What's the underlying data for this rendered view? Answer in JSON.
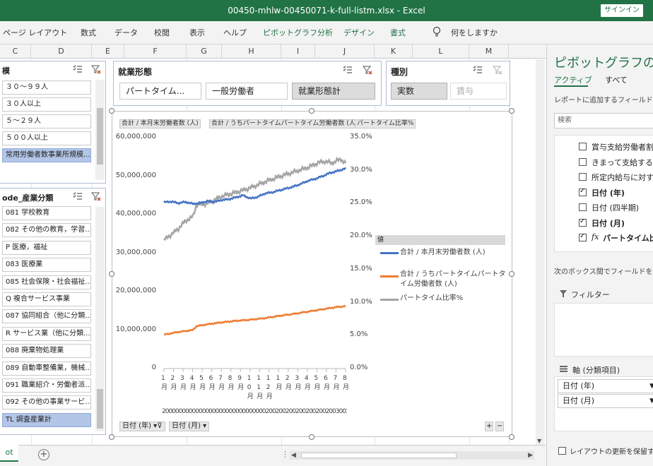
{
  "window": {
    "title": "00450-mhlw-00450071-k-full-listm.xlsx  -  Excel",
    "signin": "サインイン"
  },
  "ribbon": {
    "tabs": [
      "ページ レイアウト",
      "数式",
      "データ",
      "校閲",
      "表示",
      "ヘルプ",
      "ピボットグラフ分析",
      "デザイン",
      "書式"
    ],
    "tellme": "何をしますか"
  },
  "columns": [
    "C",
    "D",
    "E",
    "F",
    "G",
    "H",
    "I",
    "J",
    "K",
    "L",
    "M"
  ],
  "slicer_size": {
    "title": "模",
    "items": [
      "３０～９９人",
      "３０人以上",
      "５～２９人",
      "５００人以上",
      "常用労働者数事業所規模..."
    ],
    "selected_index": 4
  },
  "slicer_industry": {
    "title": "ode_産業分類",
    "items": [
      "081 学校教育",
      "082 その他の教育，学習...",
      "P 医療，福祉",
      "083 医療業",
      "085 社会保険・社会福祉...",
      "Q 複合サービス事業",
      "087 協同組合（他に分類...",
      "R サービス業（他に分類...",
      "088 廃棄物処理業",
      "089 自動車整備業，機械...",
      "091 職業紹介・労働者派...",
      "092 その他の事業サービ...",
      "TL 調査産業計"
    ],
    "selected_index": 12
  },
  "slicer_employment": {
    "title": "就業形態",
    "items": [
      "パートタイム...",
      "一般労働者",
      "就業形態計"
    ],
    "selected_index": 2
  },
  "slicer_type": {
    "title": "種別",
    "items": [
      "実数",
      "賃与"
    ],
    "selected_index": 0
  },
  "chart": {
    "field_buttons": [
      "合計 / 本月末労働者数 (人)",
      "合計 / うちパートタイムパートタイム労働者数 (人)",
      "パートタイム比率%"
    ],
    "axis_buttons": [
      "日付 (年)",
      "日付 (月)"
    ],
    "legend_header": "値",
    "legend": [
      "合計 / 本月末労働者数 (人)",
      "合計 / うちパートタイムパートタイム労働者数 (人)",
      "パートタイム比率%"
    ],
    "x_month_labels": [
      "1月",
      "2月",
      "3月",
      "4月",
      "5月",
      "6月",
      "7月",
      "8月",
      "9月",
      "10月",
      "11月",
      "12月",
      "1月",
      "2月",
      "3月",
      "4月",
      "5月",
      "6月",
      "7月",
      "8月"
    ],
    "x_year_strip": "20000000000000000000000000000002002002002002002002003003001",
    "colors": {
      "total": "#4472c4",
      "part": "#ed7d31",
      "ratio": "#a5a5a5"
    }
  },
  "chart_data": {
    "type": "line",
    "title": "",
    "y_left": {
      "ticks": [
        "0",
        "10,000,000",
        "20,000,000",
        "30,000,000",
        "40,000,000",
        "50,000,000",
        "60,000,000"
      ],
      "ylim": [
        0,
        60000000
      ]
    },
    "y_right": {
      "ticks": [
        "0.0%",
        "5.0%",
        "10.0%",
        "15.0%",
        "20.0%",
        "25.0%",
        "30.0%",
        "35.0%"
      ],
      "ylim": [
        0,
        35
      ]
    },
    "n_points": 253,
    "series": [
      {
        "name": "合計 / 本月末労働者数 (人)",
        "axis": "left",
        "points": [
          [
            0,
            43200000
          ],
          [
            10,
            43400000
          ],
          [
            20,
            43000000
          ],
          [
            30,
            43300000
          ],
          [
            40,
            42800000
          ],
          [
            50,
            43000000
          ],
          [
            60,
            43500000
          ],
          [
            70,
            43300000
          ],
          [
            80,
            43800000
          ],
          [
            90,
            44000000
          ],
          [
            100,
            44500000
          ],
          [
            110,
            45000000
          ],
          [
            120,
            44200000
          ],
          [
            130,
            44600000
          ],
          [
            140,
            45500000
          ],
          [
            150,
            45800000
          ],
          [
            160,
            46300000
          ],
          [
            170,
            46800000
          ],
          [
            180,
            47300000
          ],
          [
            190,
            48000000
          ],
          [
            200,
            48800000
          ],
          [
            210,
            49300000
          ],
          [
            220,
            50000000
          ],
          [
            230,
            50800000
          ],
          [
            240,
            51300000
          ],
          [
            252,
            52000000
          ]
        ]
      },
      {
        "name": "合計 / うちパートタイムパートタイム労働者数 (人)",
        "axis": "left",
        "points": [
          [
            0,
            8800000
          ],
          [
            20,
            9500000
          ],
          [
            40,
            10000000
          ],
          [
            45,
            11000000
          ],
          [
            60,
            11500000
          ],
          [
            80,
            12000000
          ],
          [
            100,
            12400000
          ],
          [
            120,
            12700000
          ],
          [
            140,
            13100000
          ],
          [
            160,
            13700000
          ],
          [
            180,
            14200000
          ],
          [
            200,
            14800000
          ],
          [
            220,
            15400000
          ],
          [
            240,
            16000000
          ],
          [
            252,
            16200000
          ]
        ]
      },
      {
        "name": "パートタイム比率%",
        "axis": "right",
        "points": [
          [
            0,
            19.5
          ],
          [
            10,
            20.3
          ],
          [
            20,
            21.2
          ],
          [
            30,
            22.4
          ],
          [
            40,
            23.0
          ],
          [
            45,
            24.8
          ],
          [
            60,
            25.0
          ],
          [
            80,
            26.1
          ],
          [
            100,
            26.7
          ],
          [
            120,
            27.4
          ],
          [
            140,
            28.3
          ],
          [
            160,
            29.1
          ],
          [
            180,
            29.8
          ],
          [
            200,
            30.5
          ],
          [
            210,
            31.0
          ],
          [
            220,
            31.4
          ],
          [
            235,
            31.2
          ],
          [
            245,
            31.8
          ],
          [
            252,
            31.0
          ]
        ]
      }
    ]
  },
  "pane": {
    "title": "ピボットグラフのフィ",
    "tabs": [
      "アクティブ",
      "すべて"
    ],
    "hint": "レポートに追加するフィールドを選",
    "search_placeholder": "検索",
    "fields": [
      {
        "label": "賞与支給労働者割",
        "checked": false,
        "bold": false
      },
      {
        "label": "きまって支給する給与",
        "checked": false,
        "bold": false
      },
      {
        "label": "所定内給与に対する",
        "checked": false,
        "bold": false
      },
      {
        "label": "日付 (年)",
        "checked": true,
        "bold": true
      },
      {
        "label": "日付 (四半期)",
        "checked": false,
        "bold": false
      },
      {
        "label": "日付 (月)",
        "checked": true,
        "bold": true
      },
      {
        "label": "パートタイム比",
        "checked": true,
        "bold": true,
        "fx": "fx"
      }
    ],
    "drag_hint": "次のボックス間でフィールドをドラ",
    "filter_label": "フィルター",
    "axis_label": "軸 (分類項目)",
    "axis_fields": [
      "日付 (年)",
      "日付 (月)"
    ],
    "defer_label": "レイアウトの更新を保留する"
  },
  "sheet_tab": "ot"
}
